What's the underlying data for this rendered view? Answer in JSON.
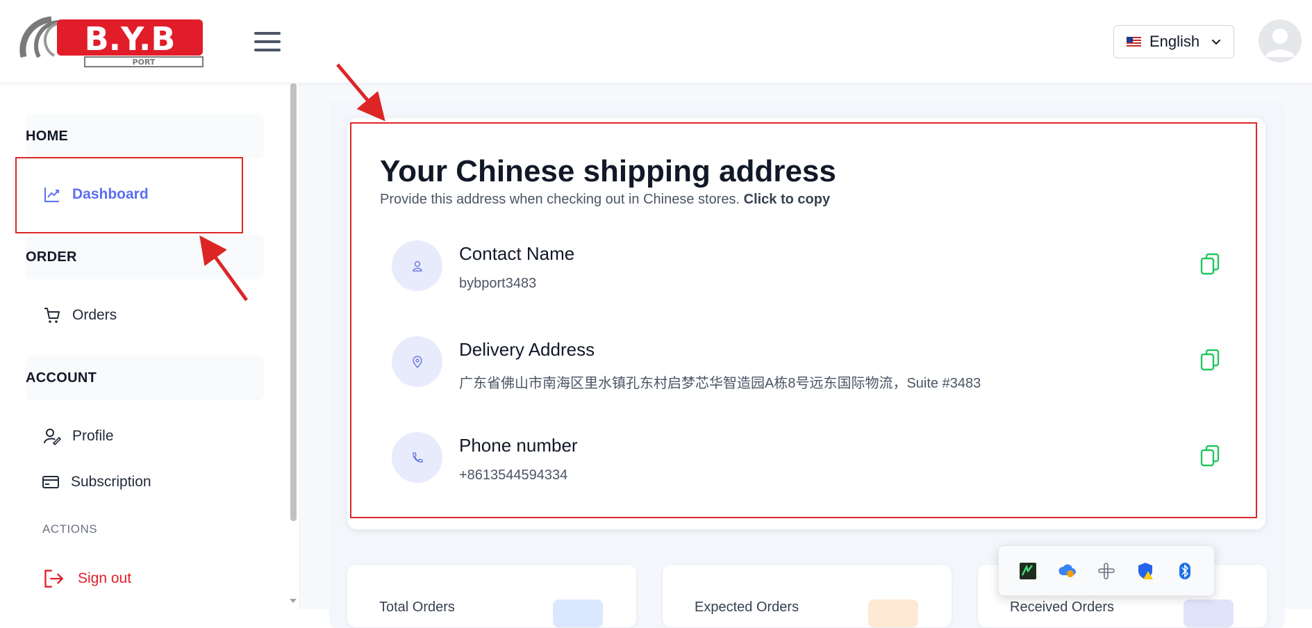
{
  "header": {
    "logo_text": "B.Y.B",
    "logo_subtext": "PORT",
    "language_label": "English"
  },
  "sidebar": {
    "sections": [
      {
        "label": "HOME"
      },
      {
        "label": "ORDER"
      },
      {
        "label": "ACCOUNT"
      }
    ],
    "items": [
      {
        "label": "Dashboard",
        "icon": "chart-line-icon"
      },
      {
        "label": "Orders",
        "icon": "cart-icon"
      },
      {
        "label": "Profile",
        "icon": "user-edit-icon"
      },
      {
        "label": "Subscription",
        "icon": "credit-card-icon"
      }
    ],
    "actions_label": "ACTIONS",
    "signout_label": "Sign out"
  },
  "address_card": {
    "title": "Your Chinese shipping address",
    "subtitle": "Provide this address when checking out in Chinese stores.",
    "subtitle_bold": "Click to copy",
    "rows": [
      {
        "label": "Contact Name",
        "value": "bybport3483",
        "icon": "user-icon"
      },
      {
        "label": "Delivery Address",
        "value": "广东省佛山市南海区里水镇孔东村启梦芯华智造园A栋8号远东国际物流，Suite #3483",
        "icon": "map-pin-icon"
      },
      {
        "label": "Phone number",
        "value": "+8613544594334",
        "icon": "phone-icon"
      }
    ]
  },
  "stats": [
    {
      "label": "Total Orders",
      "chip_color": "#dbe7fe"
    },
    {
      "label": "Expected Orders",
      "chip_color": "#fde9d4"
    },
    {
      "label": "Received Orders",
      "chip_color": "#e0e4fb"
    }
  ],
  "colors": {
    "accent": "#5b6ef0",
    "copy_icon": "#22c55e",
    "signout": "#e11d2a",
    "annotation": "#dc2626"
  },
  "tray_icons": [
    "terminal-icon",
    "cloud-sync-icon",
    "slack-icon",
    "shield-warning-icon",
    "bluetooth-icon"
  ]
}
